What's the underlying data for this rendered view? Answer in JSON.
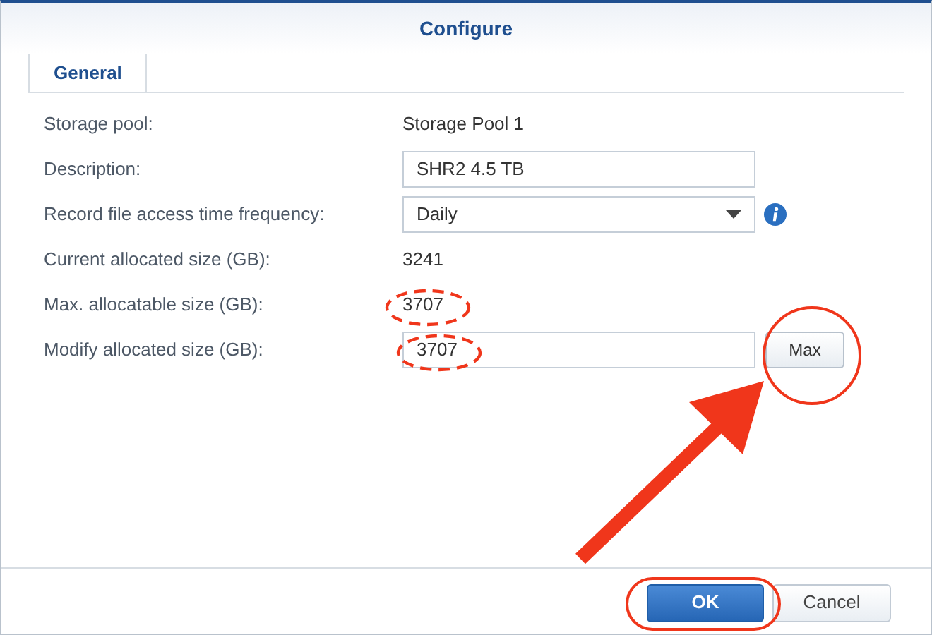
{
  "window": {
    "title": "Configure"
  },
  "tabs": [
    {
      "label": "General",
      "selected": true
    }
  ],
  "fields": [
    {
      "kind": "text",
      "label": "Storage pool:",
      "value": "Storage Pool 1"
    },
    {
      "kind": "input",
      "label": "Description:",
      "value": "SHR2 4.5 TB"
    },
    {
      "kind": "select",
      "label": "Record file access time frequency:",
      "value": "Daily"
    },
    {
      "kind": "text",
      "label": "Current allocated size (GB):",
      "value": "3241"
    },
    {
      "kind": "text",
      "label": "Max. allocatable size (GB):",
      "value": "3707"
    },
    {
      "kind": "input_button",
      "label": "Modify allocated size (GB):",
      "value": "3707",
      "button": "Max"
    }
  ],
  "buttons": [
    {
      "label": "OK",
      "primary": true
    },
    {
      "label": "Cancel",
      "primary": false
    }
  ]
}
